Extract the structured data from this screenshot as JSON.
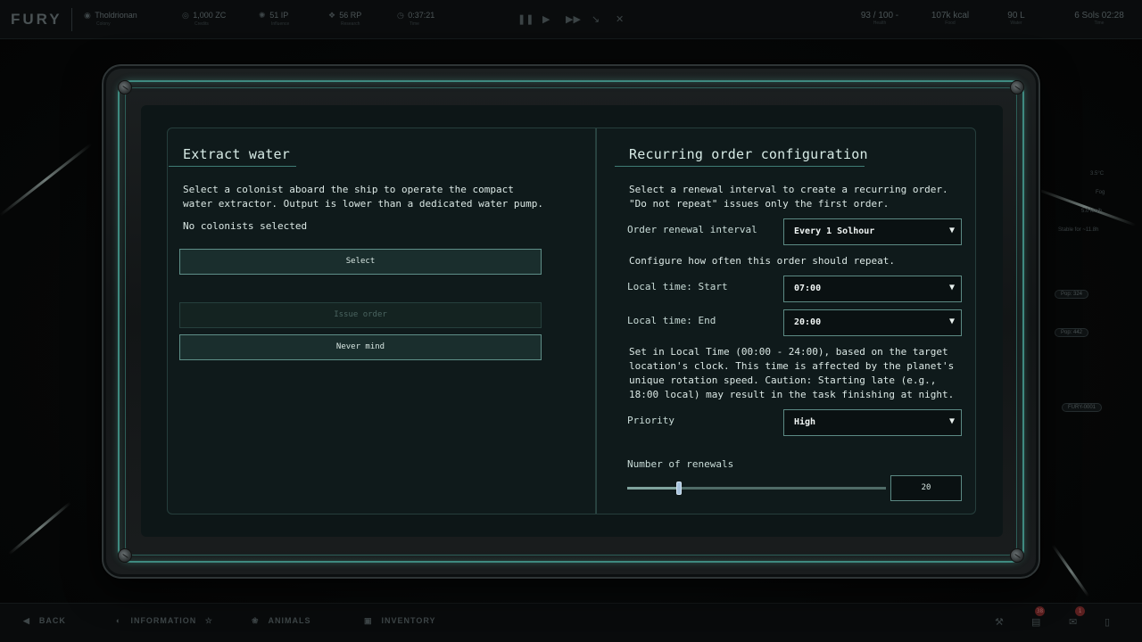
{
  "topbar": {
    "logo": "FURY",
    "location": "Tholdrionan",
    "location_sub": "Colony",
    "credits": "1,000 ZC",
    "credits_sub": "Credits",
    "influence": "51 IP",
    "influence_sub": "Influence",
    "research": "56 RP",
    "research_sub": "Research",
    "clock": "0:37:21",
    "clock_sub": "Time",
    "health": "93 / 100 -",
    "health_sub": "Health",
    "food": "107k kcal",
    "food_sub": "Food",
    "water": "90 L",
    "water_sub": "Water",
    "time": "6 Sols 02:28",
    "time_sub": "Time"
  },
  "left_panel": {
    "title": "Extract water",
    "description": "Select a colonist aboard the ship to operate the compact water extractor. Output is lower than a dedicated water pump.",
    "status": "No colonists selected",
    "select_label": "Select",
    "issue_label": "Issue order",
    "never_mind_label": "Never mind"
  },
  "right_panel": {
    "title": "Recurring order configuration",
    "description": "Select a renewal interval to create a recurring order. \"Do not repeat\" issues only the first order.",
    "interval_label": "Order renewal interval",
    "interval_value": "Every 1 Solhour",
    "configure_text": "Configure how often this order should repeat.",
    "start_label": "Local time: Start",
    "start_value": "07:00",
    "end_label": "Local time: End",
    "end_value": "20:00",
    "time_note": "Set in Local Time (00:00 - 24:00), based on the target location's clock. This time is affected by the planet's unique rotation speed. Caution: Starting late (e.g., 18:00 local) may result in the task finishing at night.",
    "priority_label": "Priority",
    "priority_value": "High",
    "renewals_label": "Number of renewals",
    "renewals_value": "20",
    "renewals_fraction": 0.2
  },
  "side_info": {
    "temp": "3.5°C",
    "weather": "Fog",
    "wind": "5.0 km/h",
    "stable": "Stable for ~11.8h",
    "pop1": "Pop: 324",
    "pop2": "Pop: 442",
    "ship_id": "FURY-0001"
  },
  "bottombar": {
    "back": "BACK",
    "information": "INFORMATION",
    "animals": "ANIMALS",
    "inventory": "INVENTORY",
    "badge1": "38",
    "badge2": "1"
  }
}
